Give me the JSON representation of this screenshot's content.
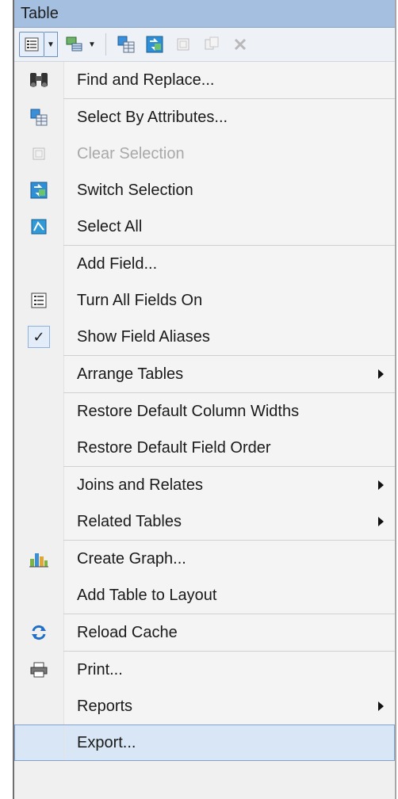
{
  "window": {
    "title": "Table"
  },
  "menu": {
    "items": [
      {
        "label": "Find and Replace...",
        "icon": "binoculars-icon"
      },
      {
        "label": "Select By Attributes...",
        "icon": "select-by-attributes-icon"
      },
      {
        "label": "Clear Selection",
        "icon": "clear-selection-icon",
        "disabled": true
      },
      {
        "label": "Switch Selection",
        "icon": "switch-selection-icon"
      },
      {
        "label": "Select All",
        "icon": "select-all-icon"
      },
      {
        "label": "Add Field..."
      },
      {
        "label": "Turn All Fields On",
        "icon": "fields-list-icon"
      },
      {
        "label": "Show Field Aliases",
        "icon": "checkmark-icon",
        "checked": true
      },
      {
        "label": "Arrange Tables",
        "submenu": true
      },
      {
        "label": "Restore Default Column Widths"
      },
      {
        "label": "Restore Default Field Order"
      },
      {
        "label": "Joins and Relates",
        "submenu": true
      },
      {
        "label": "Related Tables",
        "submenu": true
      },
      {
        "label": "Create Graph...",
        "icon": "bar-chart-icon"
      },
      {
        "label": "Add Table to Layout"
      },
      {
        "label": "Reload Cache",
        "icon": "reload-icon"
      },
      {
        "label": "Print...",
        "icon": "printer-icon"
      },
      {
        "label": "Reports",
        "submenu": true
      },
      {
        "label": "Export...",
        "highlighted": true
      }
    ]
  },
  "colors": {
    "title_bar": "#a4bfe0",
    "highlight": "#d9e6f5",
    "disabled_text": "#a9a9a9"
  }
}
